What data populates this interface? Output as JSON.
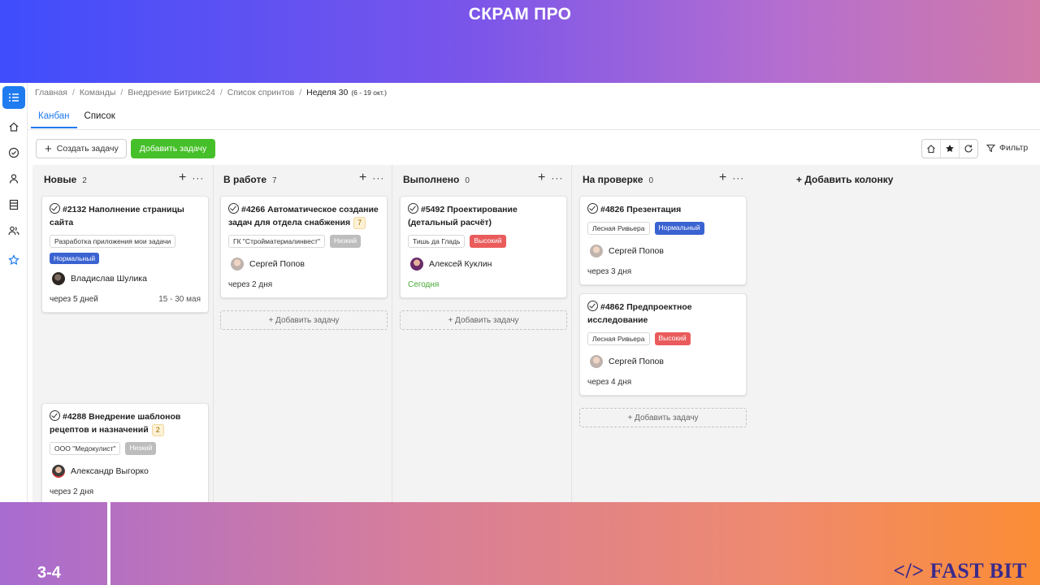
{
  "slide": {
    "title": "СКРАМ ПРО",
    "number": "3-4",
    "brand": "</> FAST BIT"
  },
  "breadcrumb": {
    "items": [
      "Главная",
      "Команды",
      "Внедрение Битрикс24",
      "Список спринтов"
    ],
    "current": "Неделя 30",
    "current_dates": "(6 - 19 окт.)"
  },
  "tabs": [
    {
      "label": "Канбан",
      "active": true
    },
    {
      "label": "Список",
      "active": false
    }
  ],
  "toolbar": {
    "create_task": "Создать задачу",
    "add_task": "Добавить задачу",
    "filter": "Фильтр"
  },
  "colors": {
    "accent": "#1f7bf0",
    "add_button": "#46c02a",
    "priority_normal": "#3a63d1",
    "priority_low": "#bdbdbd",
    "priority_high": "#ea5c5c",
    "today": "#46a832"
  },
  "board": {
    "add_column": "+ Добавить колонку",
    "add_task_label": "+ Добавить задачу",
    "columns": [
      {
        "name": "Новые",
        "count": "2",
        "cards": [
          {
            "title": "#2132 Наполнение страницы сайта",
            "badge": "",
            "tags": [
              "Разработка приложения мои задачи"
            ],
            "priority": "Нормальный",
            "priority_kind": "normal",
            "assignee": "Владислав Шулика",
            "due": "через 5 дней",
            "range": "15 - 30 мая",
            "today": false
          },
          {
            "title": "#4288 Внедрение шаблонов рецептов и назначений",
            "badge": "2",
            "tags": [
              "ООО \"Медокулист\""
            ],
            "priority": "Низкий",
            "priority_kind": "low",
            "assignee": "Александр Выгорко",
            "due": "через 2 дня",
            "range": "",
            "today": false
          }
        ]
      },
      {
        "name": "В работе",
        "count": "7",
        "cards": [
          {
            "title": "#4266 Автоматическое создание задач для отдела снабжения",
            "badge": "7",
            "tags": [
              "ГК \"Стройматериалинвест\""
            ],
            "priority": "Низкий",
            "priority_kind": "low",
            "assignee": "Сергей Попов",
            "due": "через 2 дня",
            "range": "",
            "today": false
          }
        ]
      },
      {
        "name": "Выполнено",
        "count": "0",
        "cards": [
          {
            "title": "#5492 Проектирование (детальный расчёт)",
            "badge": "",
            "tags": [
              "Тишь да Гладь"
            ],
            "priority": "Высокий",
            "priority_kind": "high",
            "assignee": "Алексей Куклин",
            "due": "Сегодня",
            "range": "",
            "today": true
          }
        ]
      },
      {
        "name": "На проверке",
        "count": "0",
        "cards": [
          {
            "title": "#4826 Презентация",
            "badge": "",
            "tags": [
              "Лесная Ривьера"
            ],
            "priority": "Нормальный",
            "priority_kind": "normal",
            "assignee": "Сергей Попов",
            "due": "через 3 дня",
            "range": "",
            "today": false
          },
          {
            "title": "#4862 Предпроектное исследование",
            "badge": "",
            "tags": [
              "Лесная Ривьера"
            ],
            "priority": "Высокий",
            "priority_kind": "high",
            "assignee": "Сергей Попов",
            "due": "через 4 дня",
            "range": "",
            "today": false
          }
        ]
      }
    ]
  }
}
